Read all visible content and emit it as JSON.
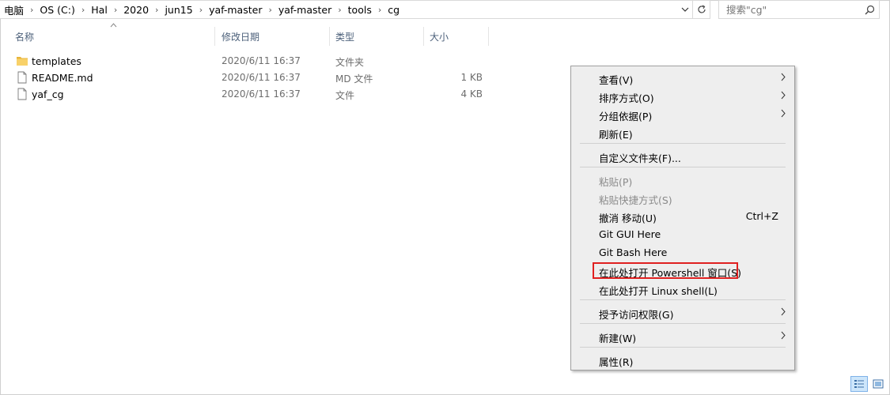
{
  "address": {
    "crumbs": [
      "电脑",
      "OS (C:)",
      "Hal",
      "2020",
      "jun15",
      "yaf-master",
      "yaf-master",
      "tools",
      "cg"
    ]
  },
  "search": {
    "placeholder": "搜索\"cg\""
  },
  "columns": {
    "name": "名称",
    "date": "修改日期",
    "type": "类型",
    "size": "大小"
  },
  "files": [
    {
      "name": "templates",
      "date": "2020/6/11 16:37",
      "type": "文件夹",
      "size": "",
      "icon": "folder-icon"
    },
    {
      "name": "README.md",
      "date": "2020/6/11 16:37",
      "type": "MD 文件",
      "size": "1 KB",
      "icon": "document-icon"
    },
    {
      "name": "yaf_cg",
      "date": "2020/6/11 16:37",
      "type": "文件",
      "size": "4 KB",
      "icon": "document-icon"
    }
  ],
  "context_menu": {
    "view": "查看(V)",
    "sort": "排序方式(O)",
    "group": "分组依据(P)",
    "refresh": "刷新(E)",
    "customize": "自定义文件夹(F)...",
    "paste": "粘贴(P)",
    "paste_shortcut": "粘贴快捷方式(S)",
    "undo_move": "撤消 移动(U)",
    "undo_shortcut": "Ctrl+Z",
    "git_gui": "Git GUI Here",
    "git_bash": "Git Bash Here",
    "powershell": "在此处打开 Powershell 窗口(S)",
    "linux_shell": "在此处打开 Linux shell(L)",
    "grant_access": "授予访问权限(G)",
    "new": "新建(W)",
    "properties": "属性(R)"
  },
  "colors": {
    "highlight_box": "#e02020",
    "menu_bg": "#eeeeee",
    "header_text": "#4c607a"
  }
}
